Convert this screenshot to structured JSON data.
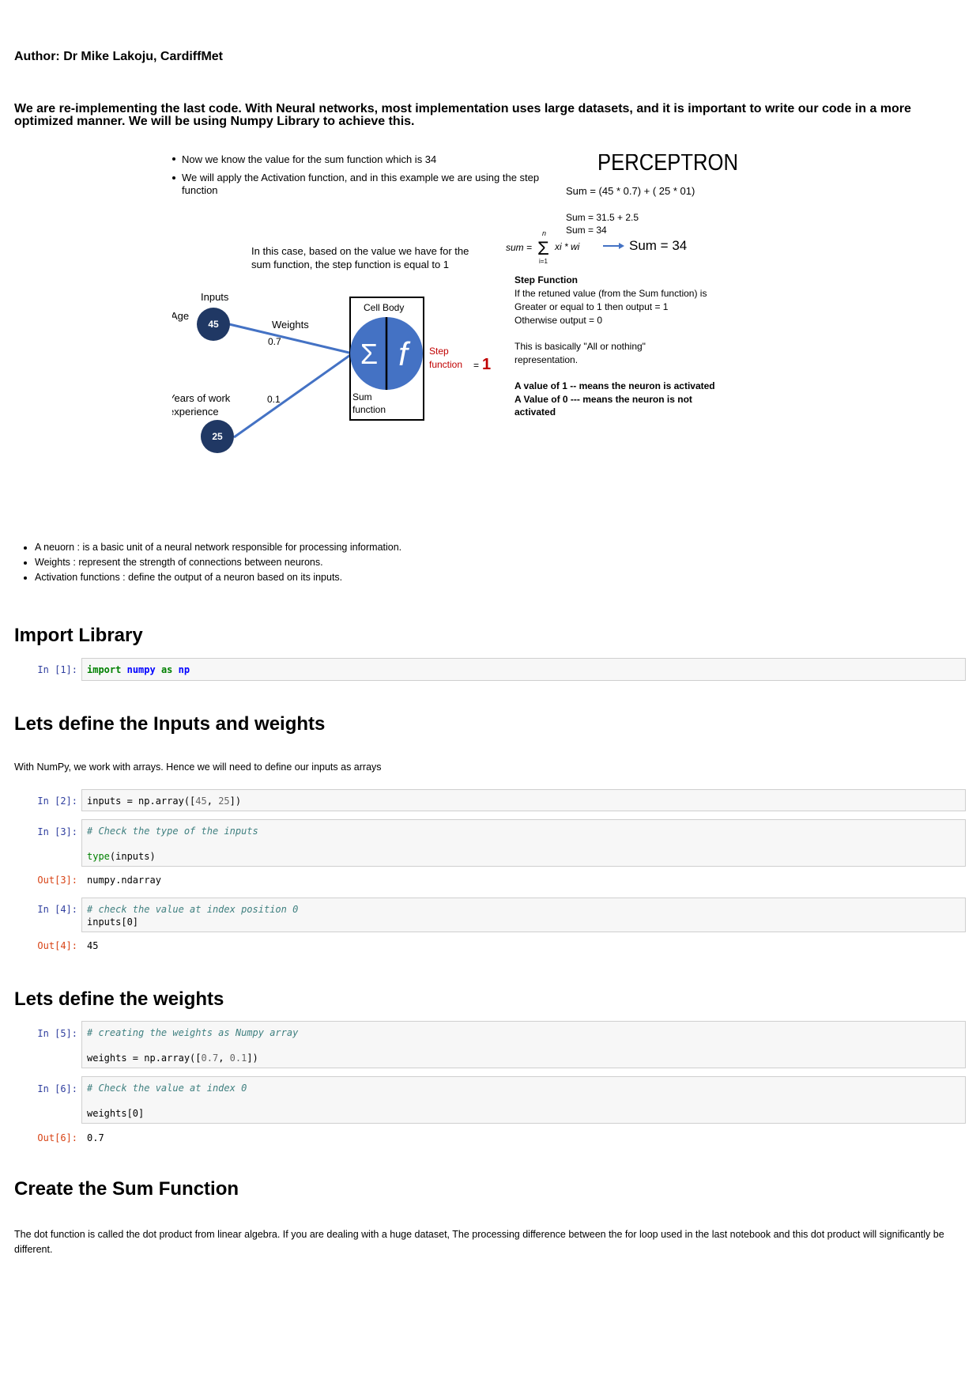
{
  "author": "Author: Dr Mike Lakoju, CardiffMet",
  "intro": "We are re-implementing the last code. With Neural networks, most implementation uses large datasets, and it is important to write our code in a more optimized manner. We will be using Numpy Library to achieve this.",
  "figure": {
    "bullet1": "Now we know the value for the sum function which is 34",
    "bullet2_line1": "We will apply the Activation function, and in this example we are using the step",
    "bullet2_line2": "function",
    "title": "PERCEPTRON",
    "sum_expr": "Sum = (45 * 0.7)  + ( 25 * 01)",
    "sum_line2": "Sum = 31.5 + 2.5",
    "sum_line3": "Sum = 34",
    "formula_lhs": "sum =",
    "formula_top": "n",
    "formula_bottom": "i=1",
    "formula_terms": "xi  * wi",
    "sum_result": "Sum = 34",
    "case_line1": "In this case, based on the value we have for the",
    "case_line2": "sum function, the step function is equal to 1",
    "inputs_label": "Inputs",
    "age_label": "Age",
    "age_value": "45",
    "weights_label": "Weights",
    "w1": "0.7",
    "w2": "0.1",
    "years_label_1": "Years of work",
    "years_label_2": "experience",
    "years_value": "25",
    "cell_body": "Cell Body",
    "sigma": "Σ",
    "fsym": "f",
    "sum_function_1": "Sum",
    "sum_function_2": "function",
    "step_label_1": "Step",
    "step_label_2": "function",
    "step_eq": "=",
    "step_value": "1",
    "step_title": "Step Function",
    "step_l1": "If the retuned value (from the Sum function) is",
    "step_l2": "Greater or equal to 1 then output =  1",
    "step_l3": "Otherwise output = 0",
    "basic_l1": "This is basically \"All or nothing\"",
    "basic_l2": "representation.",
    "val1": "A value of 1 -- means the neuron is activated",
    "val0a": " A Value of 0 ---  means the neuron is not",
    "val0b": "activated",
    "colors": {
      "node": "#203864",
      "cell": "#4472c4",
      "line": "#4472c4",
      "step": "#c00000"
    }
  },
  "bullets": [
    "A neuorn : is a basic unit of a neural network responsible for processing information.",
    "Weights : represent the strength of connections between neurons.",
    "Activation functions : define the output of a neuron based on its inputs."
  ],
  "h_import": "Import Library",
  "h_inputs": "Lets define the Inputs and weights",
  "para_numpy": "With NumPy, we work with arrays. Hence we will need to define our inputs as arrays",
  "h_weights": "Lets define the weights",
  "h_sum": "Create the Sum Function",
  "para_dot": "The dot function is called the dot product from linear algebra. If you are dealing with a huge dataset, The processing difference between the for loop used in the last notebook and this dot product will significantly be different.",
  "cells": {
    "c1": {
      "prompt": "In [1]:",
      "kw1": "import",
      "mod": "numpy",
      "kw2": "as",
      "alias": "np"
    },
    "c2": {
      "prompt": "In [2]:",
      "pre": "inputs = np.array([",
      "n1": "45",
      "sep": ", ",
      "n2": "25",
      "post": "])"
    },
    "c3": {
      "prompt": "In [3]:",
      "comment": "# Check the type of the inputs",
      "fn": "type",
      "rest": "(inputs)",
      "out_prompt": "Out[3]:",
      "out": "numpy.ndarray"
    },
    "c4": {
      "prompt": "In [4]:",
      "comment": "# check the value at index position 0",
      "code": "inputs[0]",
      "out_prompt": "Out[4]:",
      "out": "45"
    },
    "c5": {
      "prompt": "In [5]:",
      "comment": "# creating the weights as Numpy array",
      "pre": "weights = np.array([",
      "n1": "0.7",
      "sep": ", ",
      "n2": "0.1",
      "post": "])"
    },
    "c6": {
      "prompt": "In [6]:",
      "comment": "# Check the value at index 0",
      "code": "weights[0]",
      "out_prompt": "Out[6]:",
      "out": "0.7"
    }
  }
}
